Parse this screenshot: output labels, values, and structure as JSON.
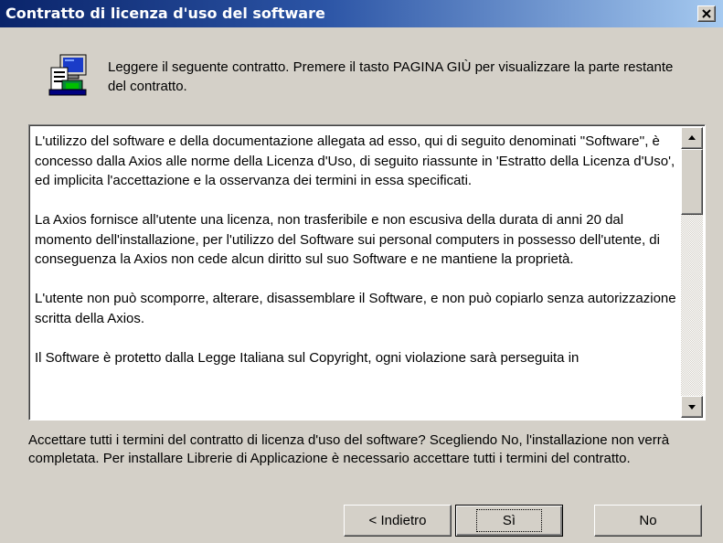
{
  "window": {
    "title": "Contratto di licenza d'uso del software",
    "close_icon": "close-icon"
  },
  "header": {
    "icon": "setup-computer-icon",
    "instruction": "Leggere il seguente contratto. Premere il tasto PAGINA GIÙ per visualizzare la parte restante del contratto."
  },
  "license": {
    "paragraphs": [
      "L'utilizzo del software e della documentazione allegata ad esso, qui di seguito denominati ''Software'', è concesso dalla Axios alle norme della Licenza d'Uso, di seguito riassunte in 'Estratto della Licenza d'Uso', ed implicita l'accettazione e la osservanza dei termini in essa specificati.",
      "La Axios fornisce all'utente una licenza, non trasferibile e non escusiva della durata di anni 20 dal momento dell'installazione, per l'utilizzo del Software sui personal computers in possesso dell'utente, di conseguenza la Axios non cede alcun diritto sul suo Software e ne mantiene la proprietà.",
      "L'utente non può scomporre, alterare, disassemblare il Software, e non può copiarlo senza autorizzazione scritta della Axios.",
      "Il Software è protetto dalla Legge Italiana sul Copyright, ogni violazione sarà perseguita in"
    ],
    "scroll_position": 0.0
  },
  "question": "Accettare tutti i termini del contratto di licenza d'uso del software? Scegliendo No, l'installazione non verrà completata. Per installare Librerie di Applicazione è necessario accettare tutti i termini del contratto.",
  "buttons": {
    "back": "< Indietro",
    "yes": "Sì",
    "no": "No"
  }
}
